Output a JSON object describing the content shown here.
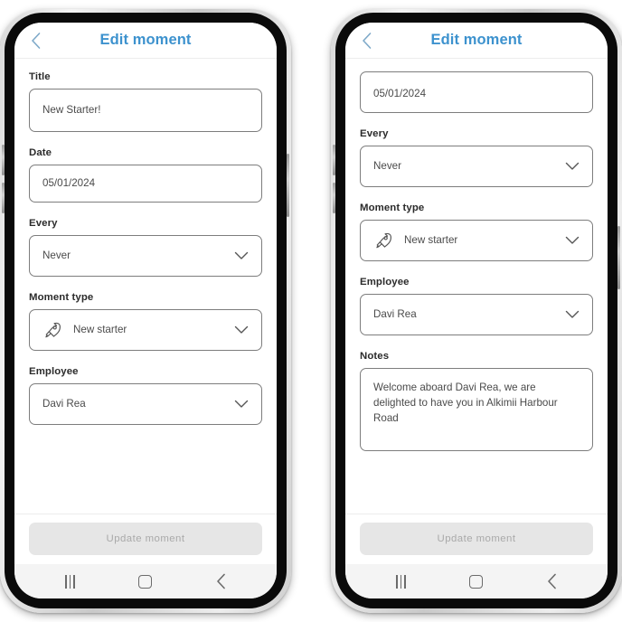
{
  "app": {
    "title": "Edit moment",
    "accent_color": "#3d92ce",
    "back_icon": "chevron-left-icon"
  },
  "labels": {
    "title": "Title",
    "date": "Date",
    "every": "Every",
    "moment_type": "Moment type",
    "employee": "Employee",
    "notes": "Notes"
  },
  "values": {
    "title": "New Starter!",
    "date": "05/01/2024",
    "every": "Never",
    "moment_type": "New starter",
    "moment_type_icon": "rocket-icon",
    "employee": "Davi Rea",
    "notes": "Welcome aboard Davi Rea, we are delighted to have you in Alkimii Harbour Road"
  },
  "submit": {
    "label": "Update moment",
    "state": "disabled",
    "bg_color": "#e6e6e6",
    "text_color": "#a9a9a9"
  },
  "nav_bar": {
    "recents": "recents-icon",
    "home": "home-icon",
    "back": "back-icon"
  },
  "screens": [
    {
      "name": "edit-moment-top",
      "scroll": "top"
    },
    {
      "name": "edit-moment-scrolled",
      "scroll": "scrolled"
    }
  ]
}
